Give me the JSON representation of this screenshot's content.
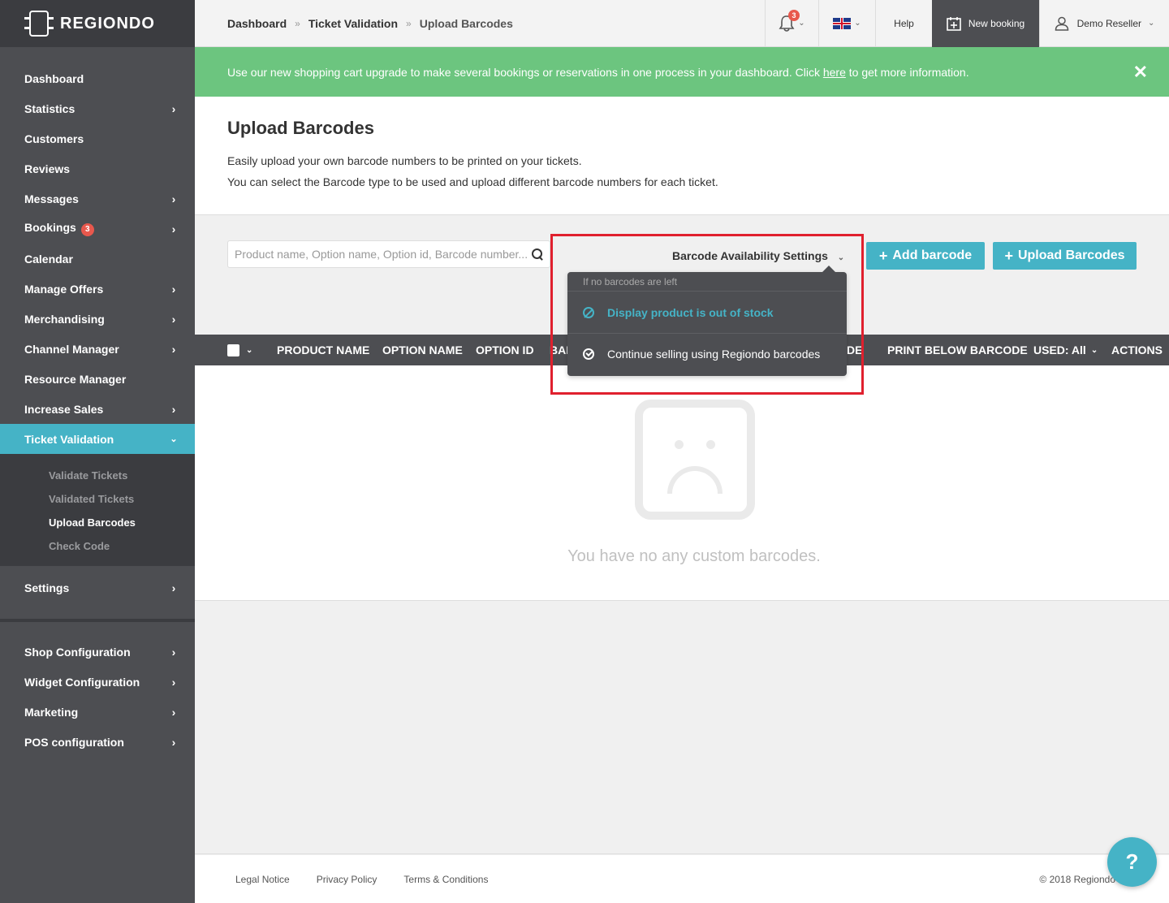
{
  "app": {
    "logo": "REGIONDO"
  },
  "topbar": {
    "breadcrumbs": [
      "Dashboard",
      "Ticket Validation",
      "Upload Barcodes"
    ],
    "breadcrumb_sep": "»",
    "notification_count": "3",
    "help": "Help",
    "new_booking": "New booking",
    "user": "Demo Reseller"
  },
  "banner": {
    "text_before": "Use our new shopping cart upgrade to make several bookings or reservations in one process in your dashboard. Click ",
    "link": "here",
    "text_after": " to get more information.",
    "close": "✕"
  },
  "sidebar": {
    "items": [
      {
        "label": "Dashboard"
      },
      {
        "label": "Statistics"
      },
      {
        "label": "Customers"
      },
      {
        "label": "Reviews"
      },
      {
        "label": "Messages"
      },
      {
        "label": "Bookings",
        "badge": "3"
      },
      {
        "label": "Calendar"
      },
      {
        "label": "Manage Offers"
      },
      {
        "label": "Merchandising"
      },
      {
        "label": "Channel Manager"
      },
      {
        "label": "Resource Manager"
      },
      {
        "label": "Increase Sales"
      },
      {
        "label": "Ticket Validation"
      }
    ],
    "subitems": [
      "Validate Tickets",
      "Validated Tickets",
      "Upload Barcodes",
      "Check Code"
    ],
    "settings": "Settings",
    "lower_items": [
      "Shop Configuration",
      "Widget Configuration",
      "Marketing",
      "POS configuration"
    ],
    "accent": "#45b3c6"
  },
  "page": {
    "title": "Upload Barcodes",
    "desc1": "Easily upload your own barcode numbers to be printed on your tickets.",
    "desc2": "You can select the Barcode type to be used and upload different barcode numbers for each ticket."
  },
  "toolbar": {
    "search_placeholder": "Product name, Option name, Option id, Barcode number...",
    "availability": "Barcode Availability Settings",
    "add": "Add barcode",
    "upload": "Upload Barcodes"
  },
  "table": {
    "columns": [
      "PRODUCT NAME",
      "OPTION NAME",
      "OPTION ID",
      "BAR",
      "DE",
      "PRINT BELOW BARCODE",
      "USED: All",
      "ACTIONS"
    ]
  },
  "dropdown": {
    "header": "If no barcodes are left",
    "options": [
      "Display product is out of stock",
      "Continue selling using Regiondo barcodes"
    ]
  },
  "empty": {
    "text": "You have no any custom barcodes."
  },
  "footer": {
    "links": [
      "Legal Notice",
      "Privacy Policy",
      "Terms & Conditions"
    ],
    "copyright": "© 2018 Regiondo"
  },
  "help_fab": "?"
}
